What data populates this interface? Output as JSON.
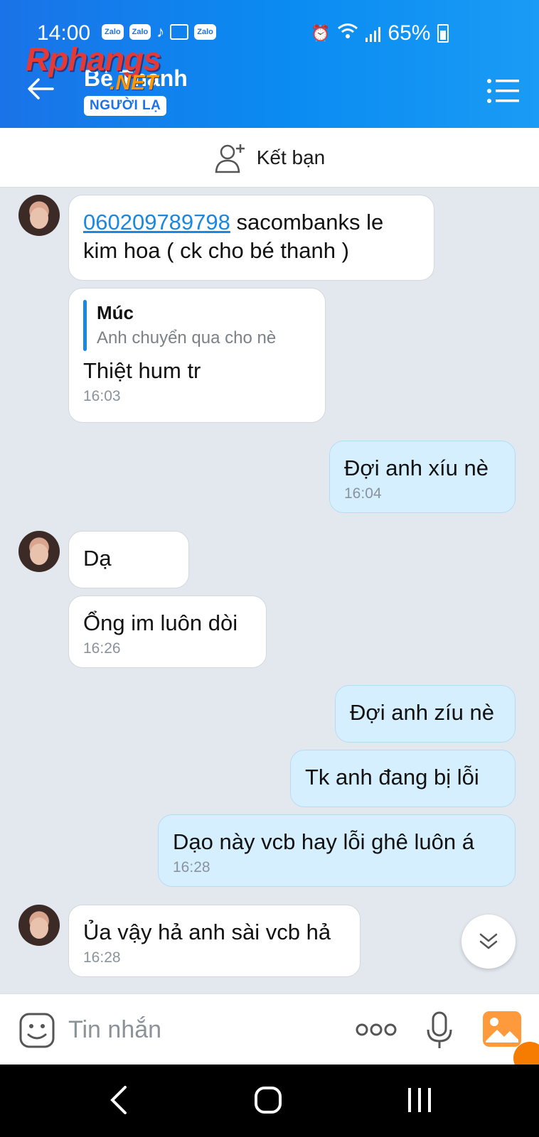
{
  "status_bar": {
    "time": "14:00",
    "notification_icons": [
      "Zalo",
      "Zalo",
      "tiktok-icon",
      "image-icon",
      "Zalo"
    ],
    "battery": "65%"
  },
  "header": {
    "contact_name": "Bé Thanh",
    "badge": "NGƯỜI LẠ",
    "watermark_main": "Rphangs",
    "watermark_sub": ".NET"
  },
  "friend_bar": {
    "label": "Kết bạn"
  },
  "messages": [
    {
      "side": "in",
      "link": "060209789798",
      "text": " sacombanks le kim hoa ( ck cho bé thanh )"
    },
    {
      "side": "in",
      "quote_name": "Múc",
      "quote_text": "Anh chuyển qua cho nè",
      "text": "Thiệt hum tr",
      "time": "16:03"
    },
    {
      "side": "out",
      "text": "Đợi anh xíu nè",
      "time": "16:04"
    },
    {
      "side": "in",
      "text": "Dạ"
    },
    {
      "side": "in",
      "text": "Ổng im luôn dòi",
      "time": "16:26"
    },
    {
      "side": "out",
      "text": "Đợi anh zíu nè"
    },
    {
      "side": "out",
      "text": "Tk anh đang bị lỗi"
    },
    {
      "side": "out",
      "text": "Dạo này vcb hay lỗi ghê luôn á",
      "time": "16:28"
    },
    {
      "side": "in",
      "text": "Ủa vậy hả anh sài vcb hả",
      "time": "16:28"
    }
  ],
  "input": {
    "placeholder": "Tin nhắn",
    "value": ""
  },
  "colors": {
    "header": "#1a73e8",
    "bubble_out": "#d6efff",
    "bubble_in": "#ffffff",
    "link": "#1a88e0",
    "background": "#e3e8ef"
  }
}
